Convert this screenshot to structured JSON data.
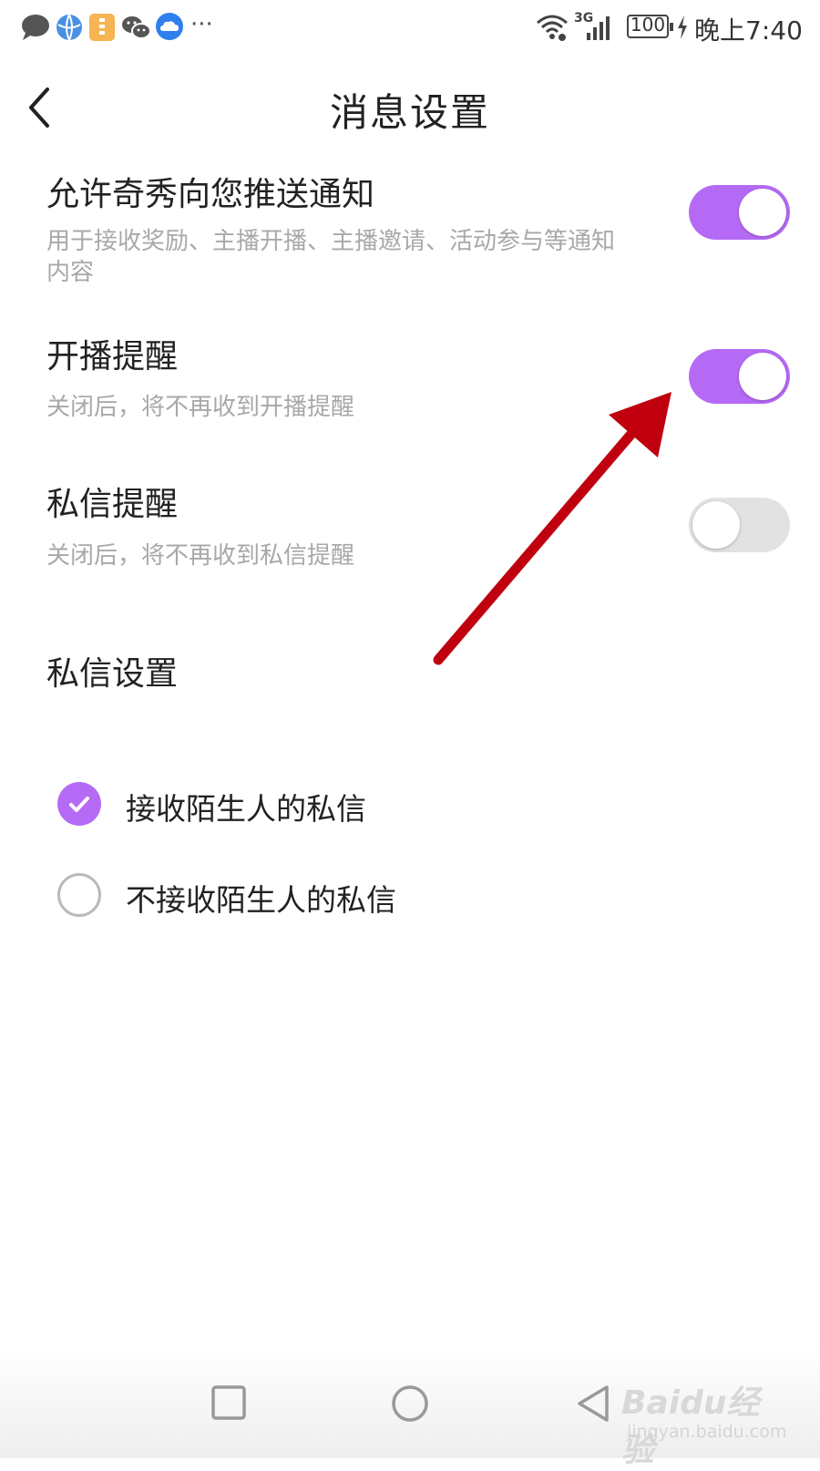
{
  "status_bar": {
    "time": "晚上7:40",
    "battery": "100",
    "network": "3G",
    "more": "···",
    "icons": [
      "message-icon",
      "browser-icon",
      "app-icon",
      "wechat-icon",
      "cloud-icon",
      "wifi-icon",
      "signal-icon",
      "battery-icon",
      "charging-icon"
    ]
  },
  "header": {
    "title": "消息设置",
    "back_icon": "chevron-left-icon"
  },
  "settings": [
    {
      "title": "允许奇秀向您推送通知",
      "description": "用于接收奖励、主播开播、主播邀请、活动参与等通知内容",
      "enabled": true
    },
    {
      "title": "开播提醒",
      "description": "关闭后，将不再收到开播提醒",
      "enabled": true
    },
    {
      "title": "私信提醒",
      "description": "关闭后，将不再收到私信提醒",
      "enabled": false
    }
  ],
  "private_message": {
    "section_title": "私信设置",
    "options": [
      {
        "label": "接收陌生人的私信",
        "selected": true
      },
      {
        "label": "不接收陌生人的私信",
        "selected": false
      }
    ]
  },
  "nav_bar": {
    "buttons": [
      "recent-apps-icon",
      "home-icon",
      "back-icon"
    ]
  },
  "watermark": {
    "brand": "Baidu经验",
    "url": "jingyan.baidu.com"
  },
  "colors": {
    "accent": "#b56af5",
    "toggle_off": "#e2e2e2",
    "arrow": "#c0000e",
    "secondary_text": "#a8a8a8"
  }
}
